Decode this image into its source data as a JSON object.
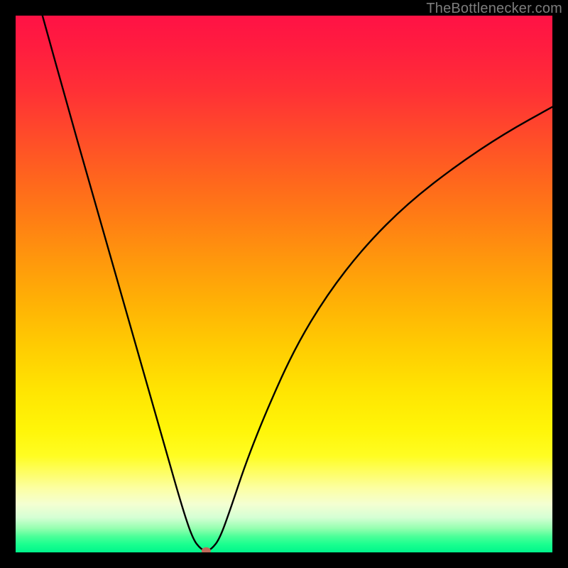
{
  "watermark": {
    "text": "TheBottlenecker.com"
  },
  "chart_data": {
    "type": "line",
    "title": "",
    "xlabel": "",
    "ylabel": "",
    "xlim": [
      0,
      100
    ],
    "ylim": [
      0,
      100
    ],
    "grid": false,
    "x": [
      5,
      10,
      13,
      16,
      19,
      22,
      25,
      28,
      31,
      33,
      34.5,
      35.5,
      36.5,
      38,
      40,
      43,
      47,
      52,
      58,
      65,
      73,
      82,
      91,
      100
    ],
    "y": [
      100,
      82,
      71.5,
      61,
      50.5,
      40,
      29.5,
      19,
      8.5,
      2.5,
      0.6,
      0.3,
      0.6,
      2.5,
      8,
      17,
      27,
      38,
      48,
      57,
      65,
      72,
      78,
      83
    ],
    "minimum_marker": {
      "x": 35.5,
      "y": 0.3
    },
    "background_gradient_stops": [
      {
        "pos": 0,
        "color": "#ff1245"
      },
      {
        "pos": 0.3,
        "color": "#ff641e"
      },
      {
        "pos": 0.62,
        "color": "#ffcd02"
      },
      {
        "pos": 0.82,
        "color": "#fffd22"
      },
      {
        "pos": 0.95,
        "color": "#96ffb0"
      },
      {
        "pos": 1.0,
        "color": "#00f58b"
      }
    ]
  }
}
